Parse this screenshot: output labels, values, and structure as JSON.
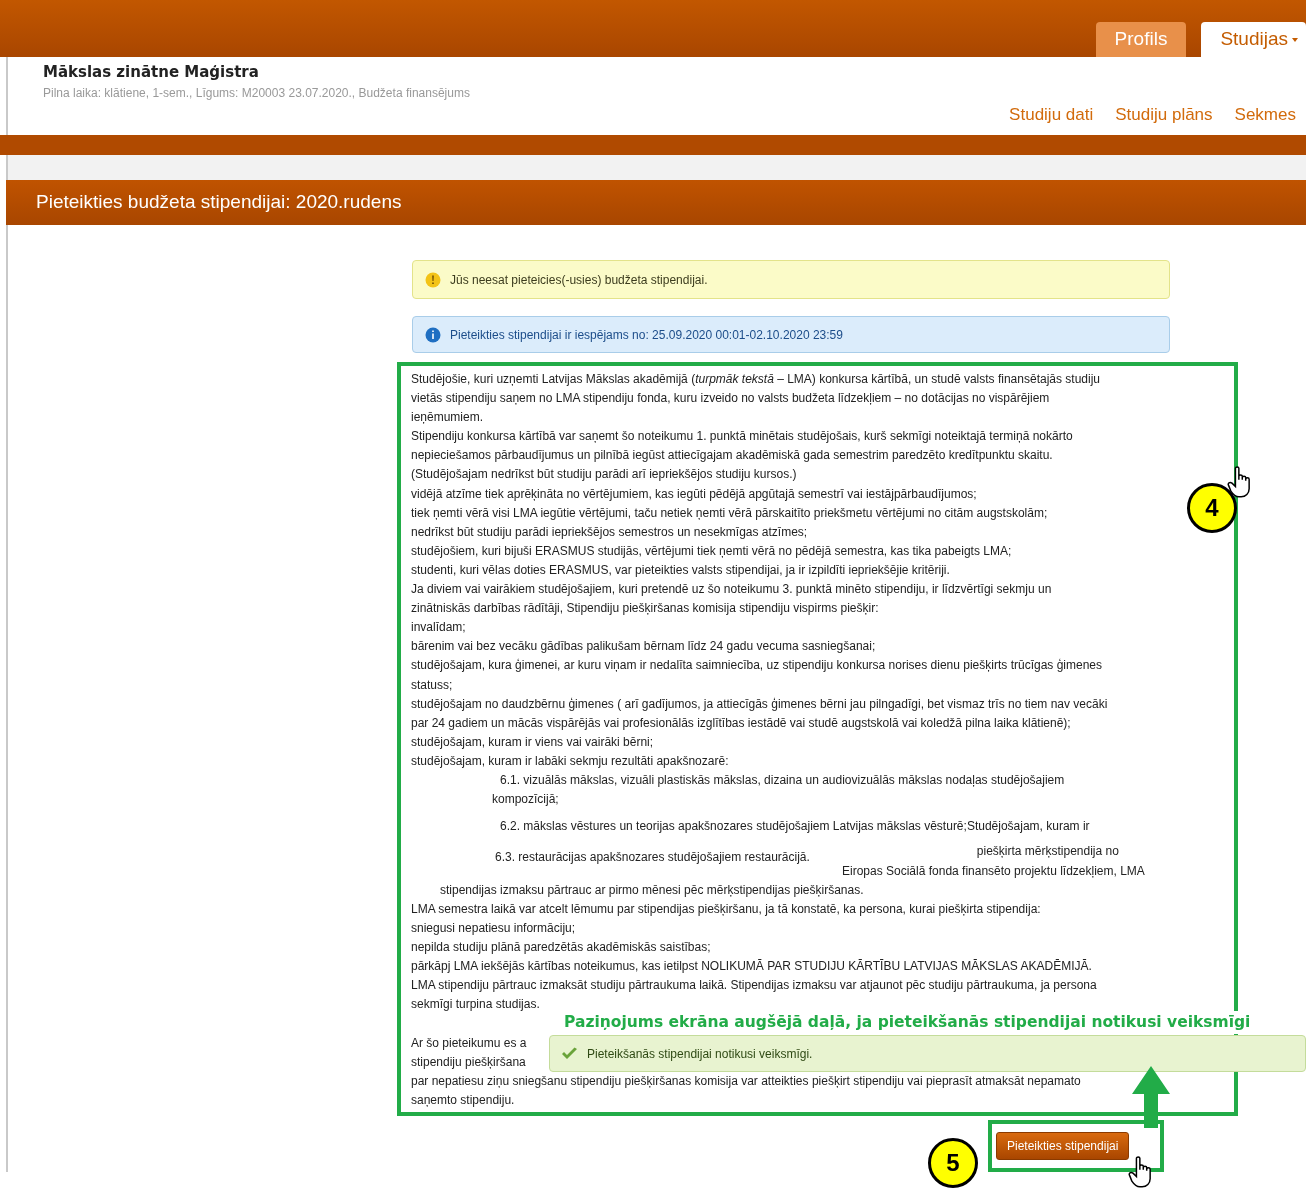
{
  "header": {
    "tabs": [
      {
        "label": "Profils",
        "selected": false
      },
      {
        "label": "Studijas",
        "selected": true
      }
    ],
    "program_title": "Mākslas zinātne Maģistra",
    "program_details": "Pilna laika: klātiene, 1-sem., Līgums: M20003 23.07.2020., Budžeta finansējums",
    "nav_links": [
      "Studiju dati",
      "Studiju plāns",
      "Sekmes"
    ]
  },
  "page_title": "Pieteikties budžeta stipendijai: 2020.rudens",
  "alerts": [
    {
      "kind": "warning",
      "text": "Jūs neesat pieteicies(-usies) budžeta stipendijai."
    },
    {
      "kind": "info",
      "text": "Pieteikties stipendijai ir iespējams no: 25.09.2020 00:01-02.10.2020 23:59"
    }
  ],
  "terms_lines": [
    {
      "kind": "line",
      "text": "Studējošie, kuri uzņemti Latvijas Mākslas akadēmijā (*turpmāk tekstā* – LMA) konkursa kārtībā, un studē valsts finansētajās studiju"
    },
    {
      "kind": "line",
      "text": "vietās stipendiju saņem no LMA stipendiju fonda, kuru izveido no valsts budžeta līdzekļiem – no dotācijas no vispārējiem"
    },
    {
      "kind": "line",
      "text": "ieņēmumiem."
    },
    {
      "kind": "line",
      "text": "Stipendiju konkursa kārtībā var saņemt šo noteikumu 1. punktā minētais studējošais, kurš sekmīgi noteiktajā termiņā nokārto"
    },
    {
      "kind": "line",
      "text": "nepieciešamos pārbaudījumus un pilnībā iegūst  attiecīgajam akadēmiskā gada semestrim paredzēto kredītpunktu skaitu."
    },
    {
      "kind": "line",
      "text": "(Studējošajam nedrīkst būt studiju parādi arī iepriekšējos studiju kursos.)"
    },
    {
      "kind": "line",
      "text": "vidējā atzīme tiek aprēķināta no vērtējumiem, kas iegūti pēdējā apgūtajā semestrī vai iestājpārbaudījumos;"
    },
    {
      "kind": "line",
      "text": "tiek ņemti vērā visi LMA iegūtie vērtējumi, taču netiek ņemti vērā pārskaitīto priekšmetu vērtējumi no citām augstskolām;"
    },
    {
      "kind": "line",
      "text": "nedrīkst būt studiju parādi iepriekšējos semestros un nesekmīgas atzīmes;"
    },
    {
      "kind": "line",
      "text": "studējošiem, kuri bijuši ERASMUS studijās, vērtējumi tiek ņemti vērā no pēdējā semestra, kas tika pabeigts LMA;"
    },
    {
      "kind": "line",
      "text": "studenti, kuri vēlas doties ERASMUS, var pieteikties valsts stipendijai, ja ir izpildīti iepriekšējie kritēriji."
    },
    {
      "kind": "line",
      "text": "Ja diviem vai vairākiem studējošajiem, kuri pretendē uz šo noteikumu 3. punktā minēto stipendiju, ir līdzvērtīgi sekmju un"
    },
    {
      "kind": "line",
      "text": "zinātniskās darbības rādītāji, Stipendiju piešķiršanas komisija stipendiju vispirms piešķir:"
    },
    {
      "kind": "line",
      "text": "invalīdam;"
    },
    {
      "kind": "line",
      "text": "bārenim vai bez vecāku gādības palikušam bērnam līdz 24 gadu vecuma sasniegšanai;"
    },
    {
      "kind": "line",
      "text": "studējošajam, kura ģimenei, ar kuru viņam ir nedalīta saimniecība, uz stipendiju konkursa norises dienu piešķirts trūcīgas ģimenes"
    },
    {
      "kind": "line",
      "text": "statuss;"
    },
    {
      "kind": "line",
      "text": "studējošajam no daudzbērnu ģimenes ( arī gadījumos, ja attiecīgās ģimenes bērni jau pilngadīgi, bet vismaz trīs no tiem nav vecāki"
    },
    {
      "kind": "line",
      "text": "par 24 gadiem un mācās vispārējās vai profesionālās izglītības iestādē vai studē augstskolā vai koledžā pilna laika klātienē);"
    },
    {
      "kind": "line",
      "text": "studējošajam, kuram ir viens vai vairāki bērni;"
    },
    {
      "kind": "line",
      "text": "studējošajam, kuram ir labāki sekmju rezultāti apakšnozarē:"
    },
    {
      "kind": "sub",
      "text": "6.1. vizuālās mākslas, vizuāli plastiskās mākslas, dizaina un audiovizuālās mākslas nodaļas studējošajiem"
    },
    {
      "kind": "sub-wrap",
      "text": "kompozīcijā;"
    },
    {
      "kind": "sub-para",
      "text": "6.2. mākslas vēstures un teorijas apakšnozares studējošajiem Latvijas mākslas vēsturē;Studējošajam, kuram ir"
    },
    {
      "kind": "pair",
      "parts": [
        "6.3. restaurācijas apakšnozares studējošajiem restaurācijā.",
        "piešķirta mērķstipendija no"
      ]
    },
    {
      "kind": "right",
      "text": "Eiropas Sociālā fonda finansēto projektu līdzekļiem, LMA"
    },
    {
      "kind": "hang",
      "text": "stipendijas izmaksu pārtrauc ar pirmo mēnesi pēc mērķstipendijas piešķiršanas."
    },
    {
      "kind": "line",
      "text": "LMA semestra laikā var atcelt lēmumu par stipendijas piešķiršanu, ja tā konstatē, ka persona, kurai piešķirta stipendija:"
    },
    {
      "kind": "line",
      "text": "sniegusi nepatiesu informāciju;"
    },
    {
      "kind": "line",
      "text": "nepilda studiju plānā paredzētās akadēmiskās saistības;"
    },
    {
      "kind": "line",
      "text": "pārkāpj LMA iekšējās kārtības noteikumus, kas ietilpst NOLIKUMĀ PAR STUDIJU KĀRTĪBU  LATVIJAS MĀKSLAS AKADĒMIJĀ."
    },
    {
      "kind": "line",
      "text": "LMA stipendiju pārtrauc izmaksāt studiju pārtraukuma laikā. Stipendijas izmaksu var atjaunot pēc studiju pārtraukuma, ja persona"
    },
    {
      "kind": "line",
      "text": "sekmīgi turpina studijas."
    },
    {
      "kind": "para",
      "text": "Ar šo pieteikumu es a"
    },
    {
      "kind": "line",
      "text": "stipendiju piešķiršana"
    },
    {
      "kind": "line",
      "text": "par nepatiesu ziņu sniegšanu stipendiju piešķiršanas komisija var atteikties piešķirt stipendiju vai pieprasīt atmaksāt nepamato"
    },
    {
      "kind": "line",
      "text": "saņemto stipendiju."
    }
  ],
  "submit_button": "Pieteikties stipendijai",
  "success_message": "Pieteikšanās stipendijai notikusi veiksmīgi.",
  "annotations": {
    "callouts": [
      "4",
      "5"
    ],
    "note": "Paziņojums ekrāna augšējā daļā, ja pieteikšanās stipendijai notikusi veiksmīgi"
  }
}
